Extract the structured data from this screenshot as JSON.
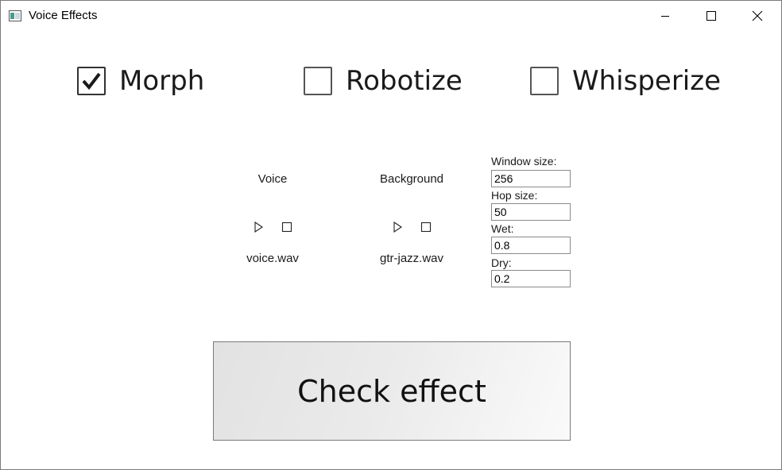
{
  "window": {
    "title": "Voice Effects",
    "icon": "app-window-icon",
    "controls": [
      "minimize-icon",
      "maximize-icon",
      "close-icon"
    ]
  },
  "effects": [
    {
      "label": "Morph",
      "checked": true
    },
    {
      "label": "Robotize",
      "checked": false
    },
    {
      "label": "Whisperize",
      "checked": false
    }
  ],
  "voice": {
    "label": "Voice",
    "file": "voice.wav",
    "play_icon": "play-icon",
    "stop_icon": "stop-icon"
  },
  "background": {
    "label": "Background",
    "file": "gtr-jazz.wav",
    "play_icon": "play-icon",
    "stop_icon": "stop-icon"
  },
  "params": {
    "window_size": {
      "label": "Window size:",
      "value": "256"
    },
    "hop_size": {
      "label": "Hop size:",
      "value": "50"
    },
    "wet": {
      "label": "Wet:",
      "value": "0.8"
    },
    "dry": {
      "label": "Dry:",
      "value": "0.2"
    }
  },
  "action": {
    "check_label": "Check effect"
  }
}
